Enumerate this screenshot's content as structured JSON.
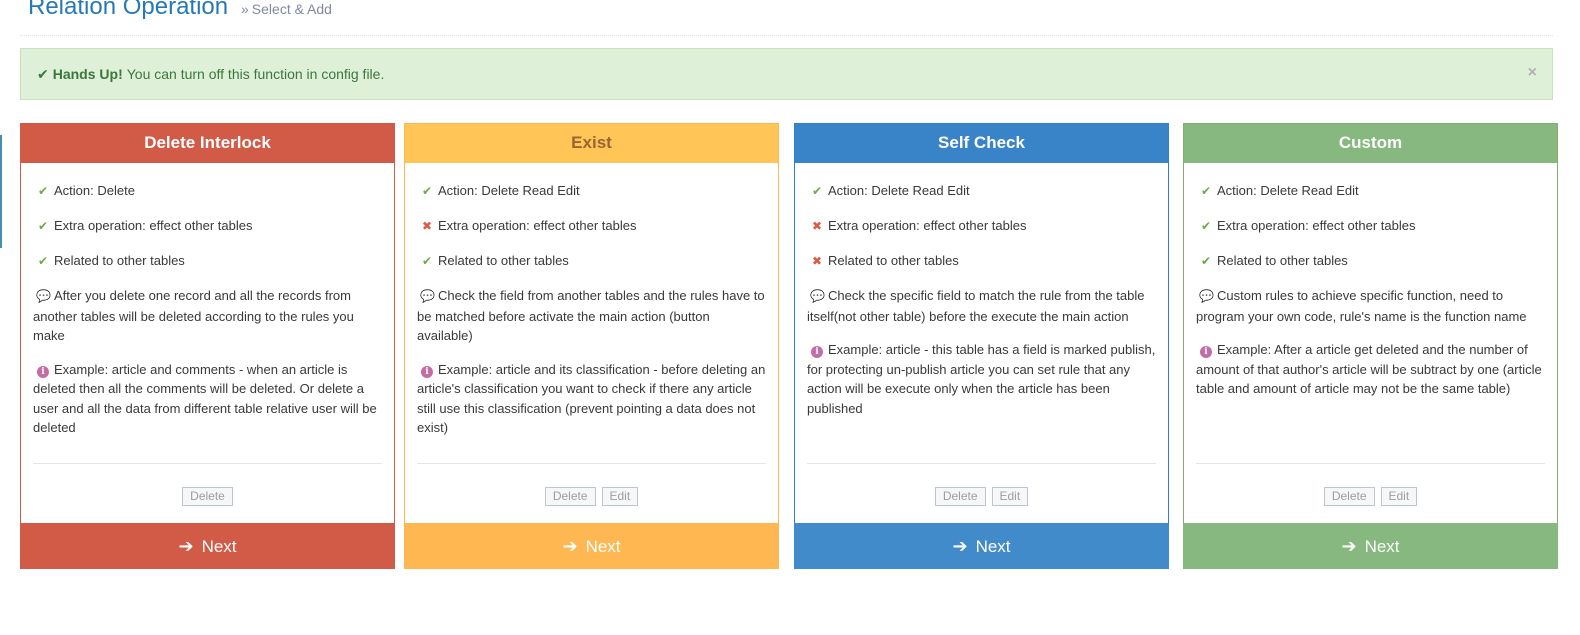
{
  "header": {
    "title": "Relation Operation",
    "sub_chevron": "»",
    "subtitle": "Select & Add"
  },
  "alert": {
    "icon": "check-icon",
    "strong": "Hands Up!",
    "message": "You can turn off this function in config file.",
    "close": "×"
  },
  "colors": {
    "red": "#d15b47",
    "yellow": "#ffb752",
    "blue": "#428bca",
    "green": "#87b87f",
    "alert_bg": "#dff0d8"
  },
  "cards": [
    {
      "title": "Delete Interlock",
      "features": [
        {
          "status": "yes",
          "text": "Action: Delete"
        },
        {
          "status": "yes",
          "text": "Extra operation: effect other tables"
        },
        {
          "status": "yes",
          "text": "Related to other tables"
        }
      ],
      "description": "After you delete one record and all the records from another tables will be deleted according to the rules you make",
      "example": "Example: article and comments - when an article is deleted then all the comments will be deleted. Or delete a user and all the data from different table relative user will be deleted",
      "buttons": [
        "Delete"
      ],
      "next": "Next"
    },
    {
      "title": "Exist",
      "features": [
        {
          "status": "yes",
          "text": "Action: Delete Read Edit"
        },
        {
          "status": "no",
          "text": "Extra operation: effect other tables"
        },
        {
          "status": "yes",
          "text": "Related to other tables"
        }
      ],
      "description": "Check the field from another tables and the rules have to be matched before activate the main action (button available)",
      "example": "Example: article and its classification - before deleting an article's classification you want to check if there any article still use this classification (prevent pointing a data does not exist)",
      "buttons": [
        "Delete",
        "Edit"
      ],
      "next": "Next"
    },
    {
      "title": "Self Check",
      "features": [
        {
          "status": "yes",
          "text": "Action: Delete Read Edit"
        },
        {
          "status": "no",
          "text": "Extra operation: effect other tables"
        },
        {
          "status": "no",
          "text": "Related to other tables"
        }
      ],
      "description": "Check the specific field to match the rule from the table itself(not other table) before the execute the main action",
      "example": "Example: article - this table has a field is marked publish, for protecting un-publish article you can set rule that any action will be execute only when the article has been published",
      "buttons": [
        "Delete",
        "Edit"
      ],
      "next": "Next"
    },
    {
      "title": "Custom",
      "features": [
        {
          "status": "yes",
          "text": "Action: Delete Read Edit"
        },
        {
          "status": "yes",
          "text": "Extra operation: effect other tables"
        },
        {
          "status": "yes",
          "text": "Related to other tables"
        }
      ],
      "description": "Custom rules to achieve specific function, need to program your own code, rule's name is the function name",
      "example": "Example: After a article get deleted and the number of amount of that author's article will be subtract by one (article table and amount of article may not be the same table)",
      "buttons": [
        "Delete",
        "Edit"
      ],
      "next": "Next"
    }
  ]
}
